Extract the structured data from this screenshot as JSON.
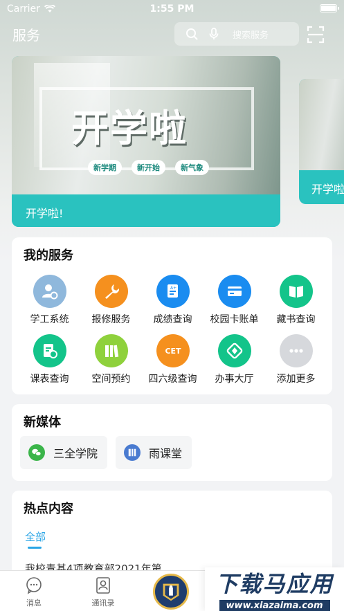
{
  "status_bar": {
    "carrier": "Carrier",
    "time": "1:55 PM"
  },
  "header": {
    "title": "服务",
    "search_placeholder": "搜索服务"
  },
  "banner": {
    "headline": "开学啦",
    "tags": [
      "新学期",
      "新开始",
      "新气象"
    ],
    "caption": "开学啦!",
    "peek_caption": "开学啦"
  },
  "services": {
    "title": "我的服务",
    "items": [
      {
        "label": "学工系统",
        "icon": "person-settings-icon",
        "color": "#8fb8dc"
      },
      {
        "label": "报修服务",
        "icon": "wrench-icon",
        "color": "#f5901e"
      },
      {
        "label": "成绩查询",
        "icon": "grade-doc-icon",
        "color": "#1a8cf0"
      },
      {
        "label": "校园卡账单",
        "icon": "card-icon",
        "color": "#1a8cf0"
      },
      {
        "label": "藏书查询",
        "icon": "book-icon",
        "color": "#13c48a"
      },
      {
        "label": "课表查询",
        "icon": "schedule-doc-icon",
        "color": "#13c48a"
      },
      {
        "label": "空间预约",
        "icon": "books-icon",
        "color": "#8fd13c"
      },
      {
        "label": "四六级查询",
        "icon": "cet-icon",
        "color": "#f5901e",
        "badge": "CET"
      },
      {
        "label": "办事大厅",
        "icon": "compass-icon",
        "color": "#13c48a"
      },
      {
        "label": "添加更多",
        "icon": "more-icon",
        "color": "#d6d8dc"
      }
    ]
  },
  "new_media": {
    "title": "新媒体",
    "items": [
      {
        "label": "三全学院",
        "icon": "wechat-icon",
        "color": "#3bb54a"
      },
      {
        "label": "雨课堂",
        "icon": "rain-class-icon",
        "color": "#4a7bd0"
      }
    ]
  },
  "hot": {
    "title": "热点内容",
    "tab": "全部",
    "first_item": "我校青基4项教育部2021年第"
  },
  "tabbar": {
    "messages": "消息",
    "contacts": "通讯录"
  },
  "watermark": {
    "title": "下载马应用",
    "url": "www.xiazaima.com"
  }
}
